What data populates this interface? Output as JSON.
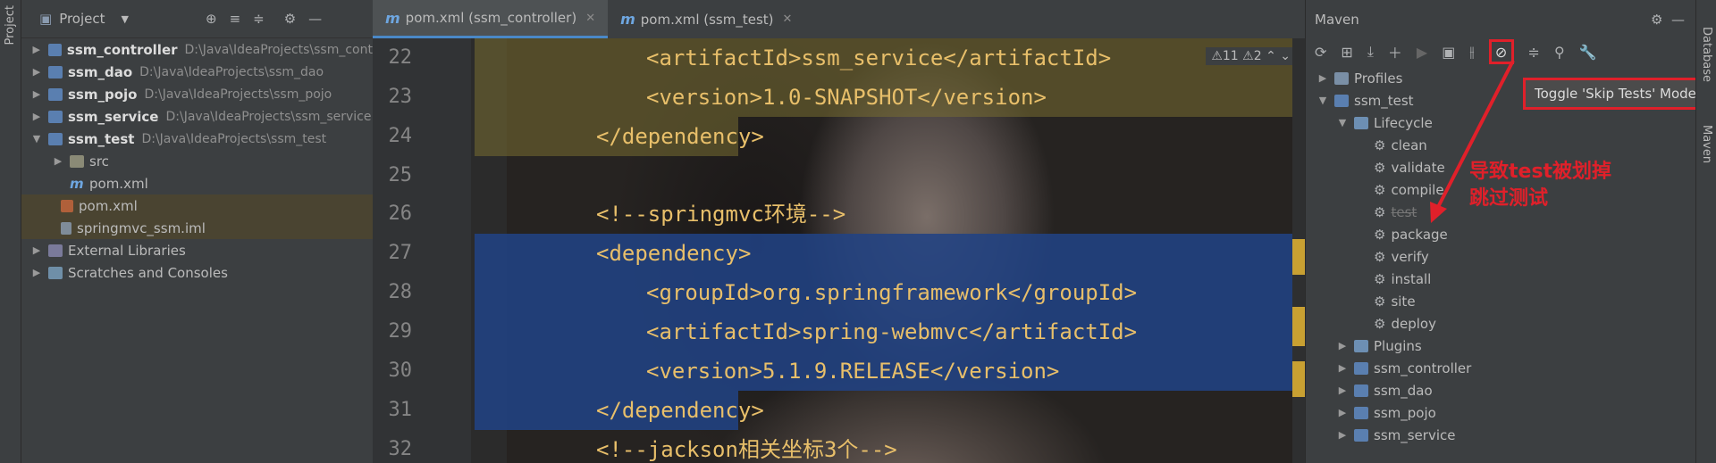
{
  "project": {
    "side_label": "Project",
    "title": "Project",
    "items": [
      {
        "name": "ssm_controller",
        "path": "D:\\Java\\IdeaProjects\\ssm_cont"
      },
      {
        "name": "ssm_dao",
        "path": "D:\\Java\\IdeaProjects\\ssm_dao"
      },
      {
        "name": "ssm_pojo",
        "path": "D:\\Java\\IdeaProjects\\ssm_pojo"
      },
      {
        "name": "ssm_service",
        "path": "D:\\Java\\IdeaProjects\\ssm_service"
      },
      {
        "name": "ssm_test",
        "path": "D:\\Java\\IdeaProjects\\ssm_test"
      }
    ],
    "src": "src",
    "test_pom": "pom.xml",
    "root_pom": "pom.xml",
    "iml": "springmvc_ssm.iml",
    "ext": "External Libraries",
    "scratch": "Scratches and Consoles"
  },
  "tabs": [
    {
      "label": "pom.xml (ssm_controller)"
    },
    {
      "label": "pom.xml (ssm_test)"
    }
  ],
  "editor": {
    "warnings": "⚠11  ⚠2",
    "lines": [
      {
        "n": "22",
        "text": "<artifactId>ssm_service</artifactId>"
      },
      {
        "n": "23",
        "text": "<version>1.0-SNAPSHOT</version>"
      },
      {
        "n": "24",
        "text": "</dependency>"
      },
      {
        "n": "25",
        "text": ""
      },
      {
        "n": "26",
        "text": "<!--springmvc环境-->"
      },
      {
        "n": "27",
        "text": "<dependency>"
      },
      {
        "n": "28",
        "text": "<groupId>org.springframework</groupId>"
      },
      {
        "n": "29",
        "text": "<artifactId>spring-webmvc</artifactId>"
      },
      {
        "n": "30",
        "text": "<version>5.1.9.RELEASE</version>"
      },
      {
        "n": "31",
        "text": "</dependency>"
      },
      {
        "n": "32",
        "text": "<!--jackson相关坐标3个-->"
      }
    ]
  },
  "maven": {
    "title": "Maven",
    "side_label": "Maven",
    "tooltip": "Toggle 'Skip Tests' Mode",
    "profiles": "Profiles",
    "module": "ssm_test",
    "lifecycle": "Lifecycle",
    "phases": [
      "clean",
      "validate",
      "compile",
      "test",
      "package",
      "verify",
      "install",
      "site",
      "deploy"
    ],
    "plugins": "Plugins",
    "others": [
      "ssm_controller",
      "ssm_dao",
      "ssm_pojo",
      "ssm_service"
    ],
    "annotation_line1": "导致test被划掉",
    "annotation_line2": "跳过测试"
  },
  "colors": {
    "accent": "#e0202a",
    "selection": "#214283",
    "tag": "#e8bf6a"
  }
}
